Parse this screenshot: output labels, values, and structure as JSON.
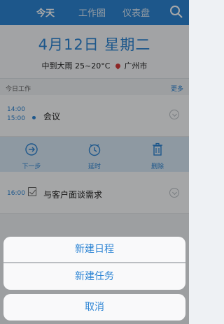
{
  "header": {
    "tabs": [
      {
        "label": "今天",
        "active": true
      },
      {
        "label": "工作圈",
        "active": false
      },
      {
        "label": "仪表盘",
        "active": false
      }
    ],
    "search_icon": "search-icon"
  },
  "today": {
    "date": "4月12日 星期二",
    "weather": "中到大雨 25~20°C",
    "location": "广州市"
  },
  "section": {
    "label": "今日工作",
    "more": "更多"
  },
  "items": [
    {
      "start": "14:00",
      "end": "15:00",
      "title": "会议"
    },
    {
      "time": "16:00",
      "title": "与客户面谈需求"
    }
  ],
  "actions": {
    "next": "下一步",
    "delay": "延时",
    "delete": "删除"
  },
  "sheet": {
    "new_schedule": "新建日程",
    "new_task": "新建任务",
    "cancel": "取消"
  },
  "colors": {
    "accent": "#2c84d4"
  }
}
